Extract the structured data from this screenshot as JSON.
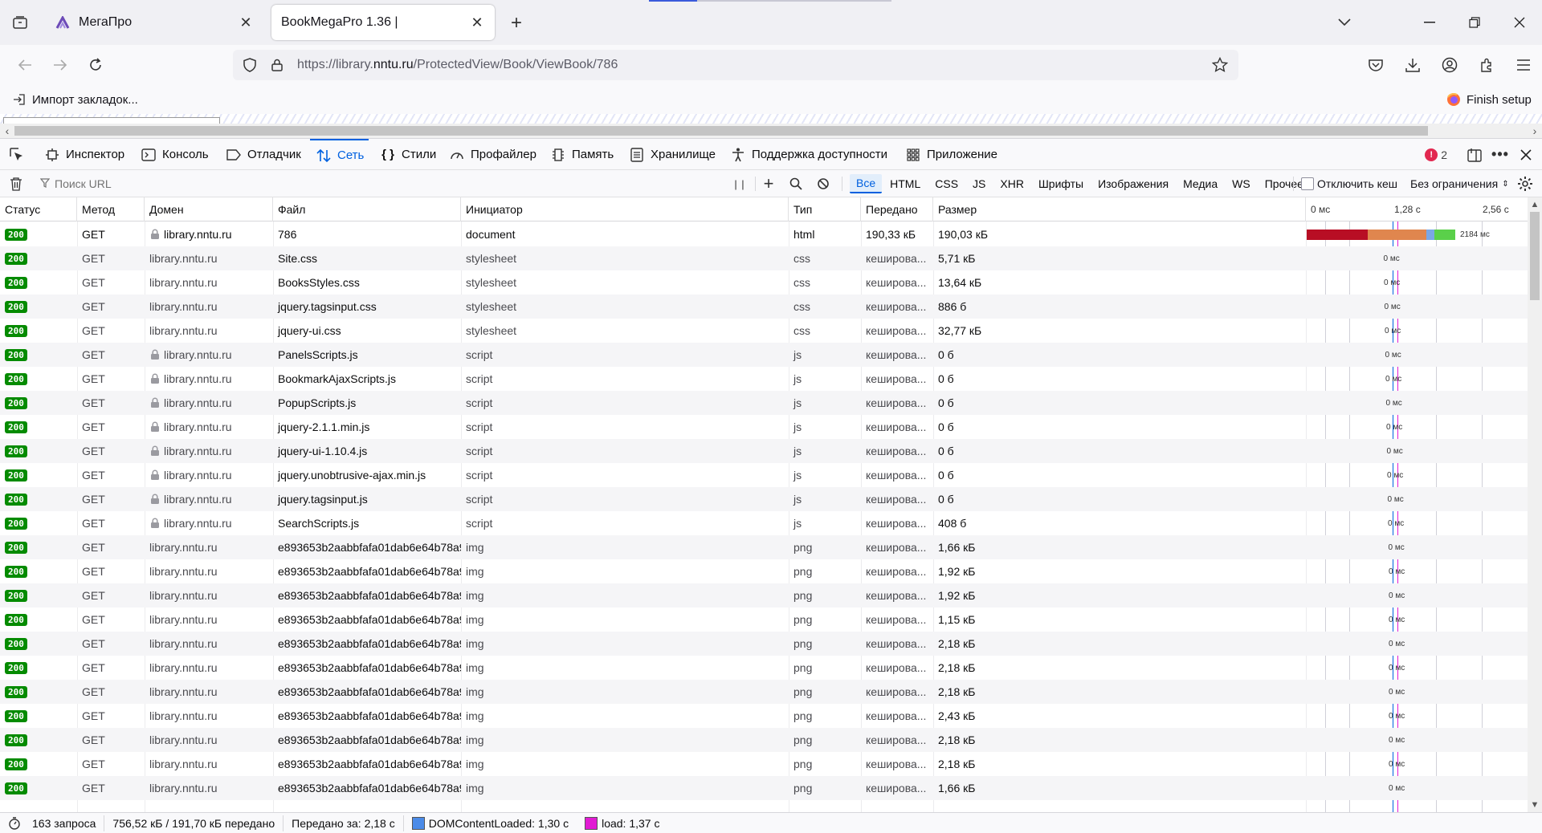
{
  "tabs": [
    {
      "title": "МегаПро"
    },
    {
      "title": "BookMegaPro 1.36 |"
    }
  ],
  "url": {
    "scheme_host": "https://library.",
    "host": "nntu.ru",
    "path": "/ProtectedView/Book/ViewBook/786"
  },
  "bookmarks": {
    "import_label": "Импорт закладок...",
    "finish_setup": "Finish setup"
  },
  "devtools": {
    "tabs": [
      "Инспектор",
      "Консоль",
      "Отладчик",
      "Сеть",
      "Стили",
      "Профайлер",
      "Память",
      "Хранилище",
      "Поддержка доступности",
      "Приложение"
    ],
    "error_count": "2"
  },
  "network": {
    "filter_placeholder": "Поиск URL",
    "filters": [
      "Все",
      "HTML",
      "CSS",
      "JS",
      "XHR",
      "Шрифты",
      "Изображения",
      "Медиа",
      "WS",
      "Прочее"
    ],
    "disable_cache": "Отключить кеш",
    "throttle": "Без ограничения",
    "columns": [
      "Статус",
      "Метод",
      "Домен",
      "Файл",
      "Инициатор",
      "Тип",
      "Передано",
      "Размер"
    ],
    "waterfall_ticks": [
      "0 мс",
      "1,28 с",
      "2,56 с"
    ],
    "first_row_timing": "2184 мс",
    "rows": [
      {
        "status": "200",
        "method": "GET",
        "domain": "library.nntu.ru",
        "lock": true,
        "file": "786",
        "initiator": "document",
        "type": "html",
        "transferred": "190,33 кБ",
        "size": "190,03 кБ",
        "time": ""
      },
      {
        "status": "200",
        "method": "GET",
        "domain": "library.nntu.ru",
        "lock": false,
        "file": "Site.css",
        "initiator": "stylesheet",
        "type": "css",
        "transferred": "кеширова...",
        "size": "5,71 кБ",
        "time": "0 мс"
      },
      {
        "status": "200",
        "method": "GET",
        "domain": "library.nntu.ru",
        "lock": false,
        "file": "BooksStyles.css",
        "initiator": "stylesheet",
        "type": "css",
        "transferred": "кеширова...",
        "size": "13,64 кБ",
        "time": "0 мс"
      },
      {
        "status": "200",
        "method": "GET",
        "domain": "library.nntu.ru",
        "lock": false,
        "file": "jquery.tagsinput.css",
        "initiator": "stylesheet",
        "type": "css",
        "transferred": "кеширова...",
        "size": "886 б",
        "time": "0 мс"
      },
      {
        "status": "200",
        "method": "GET",
        "domain": "library.nntu.ru",
        "lock": false,
        "file": "jquery-ui.css",
        "initiator": "stylesheet",
        "type": "css",
        "transferred": "кеширова...",
        "size": "32,77 кБ",
        "time": "0 мс"
      },
      {
        "status": "200",
        "method": "GET",
        "domain": "library.nntu.ru",
        "lock": true,
        "file": "PanelsScripts.js",
        "initiator": "script",
        "type": "js",
        "transferred": "кеширова...",
        "size": "0 б",
        "time": "0 мс"
      },
      {
        "status": "200",
        "method": "GET",
        "domain": "library.nntu.ru",
        "lock": true,
        "file": "BookmarkAjaxScripts.js",
        "initiator": "script",
        "type": "js",
        "transferred": "кеширова...",
        "size": "0 б",
        "time": "0 мс"
      },
      {
        "status": "200",
        "method": "GET",
        "domain": "library.nntu.ru",
        "lock": true,
        "file": "PopupScripts.js",
        "initiator": "script",
        "type": "js",
        "transferred": "кеширова...",
        "size": "0 б",
        "time": "0 мс"
      },
      {
        "status": "200",
        "method": "GET",
        "domain": "library.nntu.ru",
        "lock": true,
        "file": "jquery-2.1.1.min.js",
        "initiator": "script",
        "type": "js",
        "transferred": "кеширова...",
        "size": "0 б",
        "time": "0 мс"
      },
      {
        "status": "200",
        "method": "GET",
        "domain": "library.nntu.ru",
        "lock": true,
        "file": "jquery-ui-1.10.4.js",
        "initiator": "script",
        "type": "js",
        "transferred": "кеширова...",
        "size": "0 б",
        "time": "0 мс"
      },
      {
        "status": "200",
        "method": "GET",
        "domain": "library.nntu.ru",
        "lock": true,
        "file": "jquery.unobtrusive-ajax.min.js",
        "initiator": "script",
        "type": "js",
        "transferred": "кеширова...",
        "size": "0 б",
        "time": "0 мс"
      },
      {
        "status": "200",
        "method": "GET",
        "domain": "library.nntu.ru",
        "lock": true,
        "file": "jquery.tagsinput.js",
        "initiator": "script",
        "type": "js",
        "transferred": "кеширова...",
        "size": "0 б",
        "time": "0 мс"
      },
      {
        "status": "200",
        "method": "GET",
        "domain": "library.nntu.ru",
        "lock": true,
        "file": "SearchScripts.js",
        "initiator": "script",
        "type": "js",
        "transferred": "кеширова...",
        "size": "408 б",
        "time": "0 мс"
      },
      {
        "status": "200",
        "method": "GET",
        "domain": "library.nntu.ru",
        "lock": false,
        "file": "e893653b2aabbfafa01dab6e64b78a9(",
        "initiator": "img",
        "type": "png",
        "transferred": "кеширова...",
        "size": "1,66 кБ",
        "time": "0 мс"
      },
      {
        "status": "200",
        "method": "GET",
        "domain": "library.nntu.ru",
        "lock": false,
        "file": "e893653b2aabbfafa01dab6e64b78a9(",
        "initiator": "img",
        "type": "png",
        "transferred": "кеширова...",
        "size": "1,92 кБ",
        "time": "0 мс"
      },
      {
        "status": "200",
        "method": "GET",
        "domain": "library.nntu.ru",
        "lock": false,
        "file": "e893653b2aabbfafa01dab6e64b78a9(",
        "initiator": "img",
        "type": "png",
        "transferred": "кеширова...",
        "size": "1,92 кБ",
        "time": "0 мс"
      },
      {
        "status": "200",
        "method": "GET",
        "domain": "library.nntu.ru",
        "lock": false,
        "file": "e893653b2aabbfafa01dab6e64b78a9(",
        "initiator": "img",
        "type": "png",
        "transferred": "кеширова...",
        "size": "1,15 кБ",
        "time": "0 мс"
      },
      {
        "status": "200",
        "method": "GET",
        "domain": "library.nntu.ru",
        "lock": false,
        "file": "e893653b2aabbfafa01dab6e64b78a9(",
        "initiator": "img",
        "type": "png",
        "transferred": "кеширова...",
        "size": "2,18 кБ",
        "time": "0 мс"
      },
      {
        "status": "200",
        "method": "GET",
        "domain": "library.nntu.ru",
        "lock": false,
        "file": "e893653b2aabbfafa01dab6e64b78a9(",
        "initiator": "img",
        "type": "png",
        "transferred": "кеширова...",
        "size": "2,18 кБ",
        "time": "0 мс"
      },
      {
        "status": "200",
        "method": "GET",
        "domain": "library.nntu.ru",
        "lock": false,
        "file": "e893653b2aabbfafa01dab6e64b78a9(",
        "initiator": "img",
        "type": "png",
        "transferred": "кеширова...",
        "size": "2,18 кБ",
        "time": "0 мс"
      },
      {
        "status": "200",
        "method": "GET",
        "domain": "library.nntu.ru",
        "lock": false,
        "file": "e893653b2aabbfafa01dab6e64b78a9(",
        "initiator": "img",
        "type": "png",
        "transferred": "кеширова...",
        "size": "2,43 кБ",
        "time": "0 мс"
      },
      {
        "status": "200",
        "method": "GET",
        "domain": "library.nntu.ru",
        "lock": false,
        "file": "e893653b2aabbfafa01dab6e64b78a9(",
        "initiator": "img",
        "type": "png",
        "transferred": "кеширова...",
        "size": "2,18 кБ",
        "time": "0 мс"
      },
      {
        "status": "200",
        "method": "GET",
        "domain": "library.nntu.ru",
        "lock": false,
        "file": "e893653b2aabbfafa01dab6e64b78a9(",
        "initiator": "img",
        "type": "png",
        "transferred": "кеширова...",
        "size": "2,18 кБ",
        "time": "0 мс"
      },
      {
        "status": "200",
        "method": "GET",
        "domain": "library.nntu.ru",
        "lock": false,
        "file": "e893653b2aabbfafa01dab6e64b78a9(",
        "initiator": "img",
        "type": "png",
        "transferred": "кеширова...",
        "size": "1,66 кБ",
        "time": "0 мс"
      }
    ]
  },
  "status_bar": {
    "requests": "163 запроса",
    "transferred": "756,52 кБ / 191,70 кБ передано",
    "finish": "Передано за: 2,18 с",
    "dom_content_loaded": "DOMContentLoaded: 1,30 с",
    "load": "load: 1,37 с"
  },
  "colors": {
    "accent": "#0061e0",
    "status_ok": "#058b00",
    "dom_line": "#0060df",
    "load_line": "#e11bd3"
  }
}
